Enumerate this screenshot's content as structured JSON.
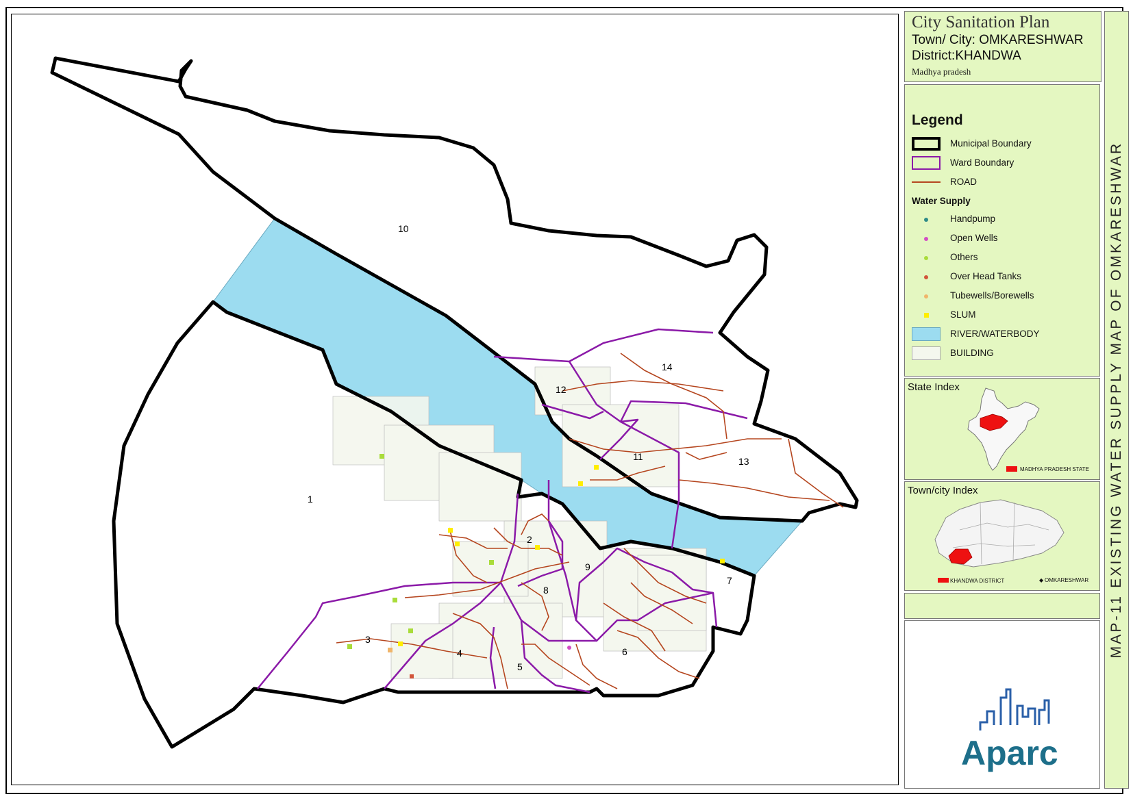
{
  "title_block": {
    "plan_title": "City Sanitation Plan",
    "town_line": "Town/ City: OMKARESHWAR",
    "district_line": "District:KHANDWA",
    "state_line": "Madhya pradesh"
  },
  "legend": {
    "title": "Legend",
    "municipal_boundary": "Municipal Boundary",
    "ward_boundary": "Ward Boundary",
    "road": "ROAD",
    "water_supply_heading": "Water Supply",
    "handpump": "Handpump",
    "open_wells": "Open Wells",
    "others": "Others",
    "over_head_tanks": "Over Head Tanks",
    "tubewells": "Tubewells/Borewells",
    "slum": "SLUM",
    "river": "RIVER/WATERBODY",
    "building": "BUILDING"
  },
  "colors": {
    "municipal_boundary": "#000000",
    "ward_boundary": "#8b1aa8",
    "road": "#b5461f",
    "river": "#9cdcf0",
    "building_fill": "#f4f7ee",
    "panel_bg": "#e4f7c1",
    "handpump": "#2e8b88",
    "open_wells": "#d24fc4",
    "others": "#a9dc3a",
    "over_head_tanks": "#d2553a",
    "tubewells": "#f0b56a",
    "slum": "#ffee00",
    "highlight": "#ee1111"
  },
  "state_index": {
    "title": "State Index",
    "caption": "MADHYA PRADESH STATE"
  },
  "town_index": {
    "title": "Town/city Index",
    "district_caption": "KHANDWA DISTRICT",
    "town_caption": "OMKARESHWAR"
  },
  "side_title": "MAP-11 EXISTING WATER SUPPLY MAP OF OMKARESHWAR",
  "logo": {
    "text": "Aparc",
    "icon": "city-skyline-icon"
  },
  "wards": [
    "1",
    "2",
    "3",
    "4",
    "5",
    "6",
    "7",
    "8",
    "9",
    "10",
    "11",
    "12",
    "13",
    "14"
  ]
}
